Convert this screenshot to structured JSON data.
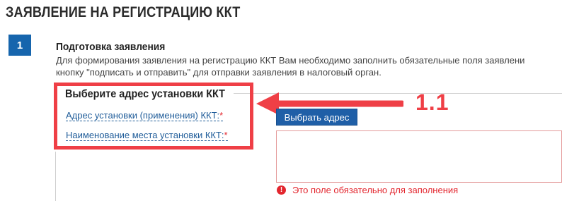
{
  "page": {
    "title": "ЗАЯВЛЕНИЕ НА РЕГИСТРАЦИЮ ККТ"
  },
  "step": {
    "number": "1",
    "title": "Подготовка заявления",
    "description_line1": "Для формирования заявления на регистрацию ККТ Вам необходимо заполнить обязательные поля заявлени",
    "description_line2": "кнопку \"подписать и отправить\" для отправки заявления в налоговый орган."
  },
  "section": {
    "title": "Выберите адрес установки ККТ",
    "address_link": "Адрес установки (применения) ККТ:",
    "place_link": "Наименование места установки ККТ:",
    "required_mark": "*"
  },
  "annotation": {
    "label": "1.1",
    "color": "#ef3f46"
  },
  "form": {
    "select_address_button": "Выбрать адрес",
    "place_value": "",
    "error_text": "Это поле обязательно для заполнения",
    "error_icon_glyph": "!"
  },
  "colors": {
    "accent_blue": "#1665ad",
    "link_blue": "#1f5c99",
    "error_red": "#e3262e"
  }
}
